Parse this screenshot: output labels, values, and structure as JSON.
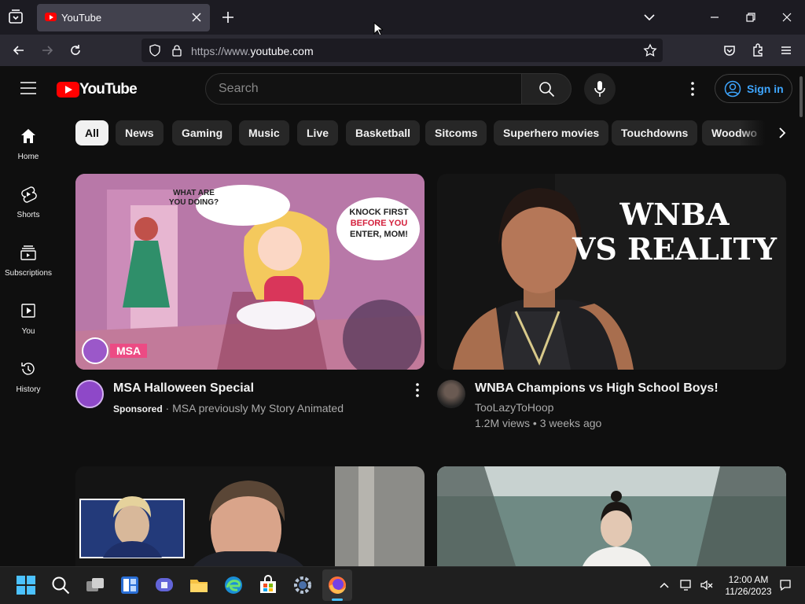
{
  "browser": {
    "tab_title": "YouTube",
    "url_prefix": "https://www.",
    "url_domain": "youtube.com"
  },
  "header": {
    "logo_text": "YouTube",
    "search_placeholder": "Search",
    "signin_label": "Sign in"
  },
  "sidebar": {
    "items": [
      {
        "label": "Home",
        "icon": "home-icon"
      },
      {
        "label": "Shorts",
        "icon": "shorts-icon"
      },
      {
        "label": "Subscriptions",
        "icon": "subscriptions-icon"
      },
      {
        "label": "You",
        "icon": "you-icon"
      },
      {
        "label": "History",
        "icon": "history-icon"
      }
    ]
  },
  "chips": [
    "All",
    "News",
    "Gaming",
    "Music",
    "Live",
    "Basketball",
    "Sitcoms",
    "Superhero movies",
    "Touchdowns",
    "Woodwo"
  ],
  "videos": [
    {
      "title": "MSA Halloween Special",
      "sponsored": "Sponsored",
      "channel": "MSA previously My Story Animated",
      "thumb_text": {
        "bubble1": "WHAT ARE YOU DOING?",
        "bubble2_a": "KNOCK FIRST",
        "bubble2_b": "BEFORE YOU",
        "bubble2_c": "ENTER, MOM!",
        "badge": "MSA"
      }
    },
    {
      "title": "WNBA Champions vs High School Boys!",
      "channel": "TooLazyToHoop",
      "stats": "1.2M views • 3 weeks ago",
      "thumb_text": {
        "line1": "WNBA",
        "line2": "VS REALITY"
      }
    }
  ],
  "taskbar": {
    "time": "12:00 AM",
    "date": "11/26/2023"
  },
  "colors": {
    "brand_red": "#ff0000",
    "link_blue": "#3ea6ff",
    "background": "#0f0f0f"
  }
}
